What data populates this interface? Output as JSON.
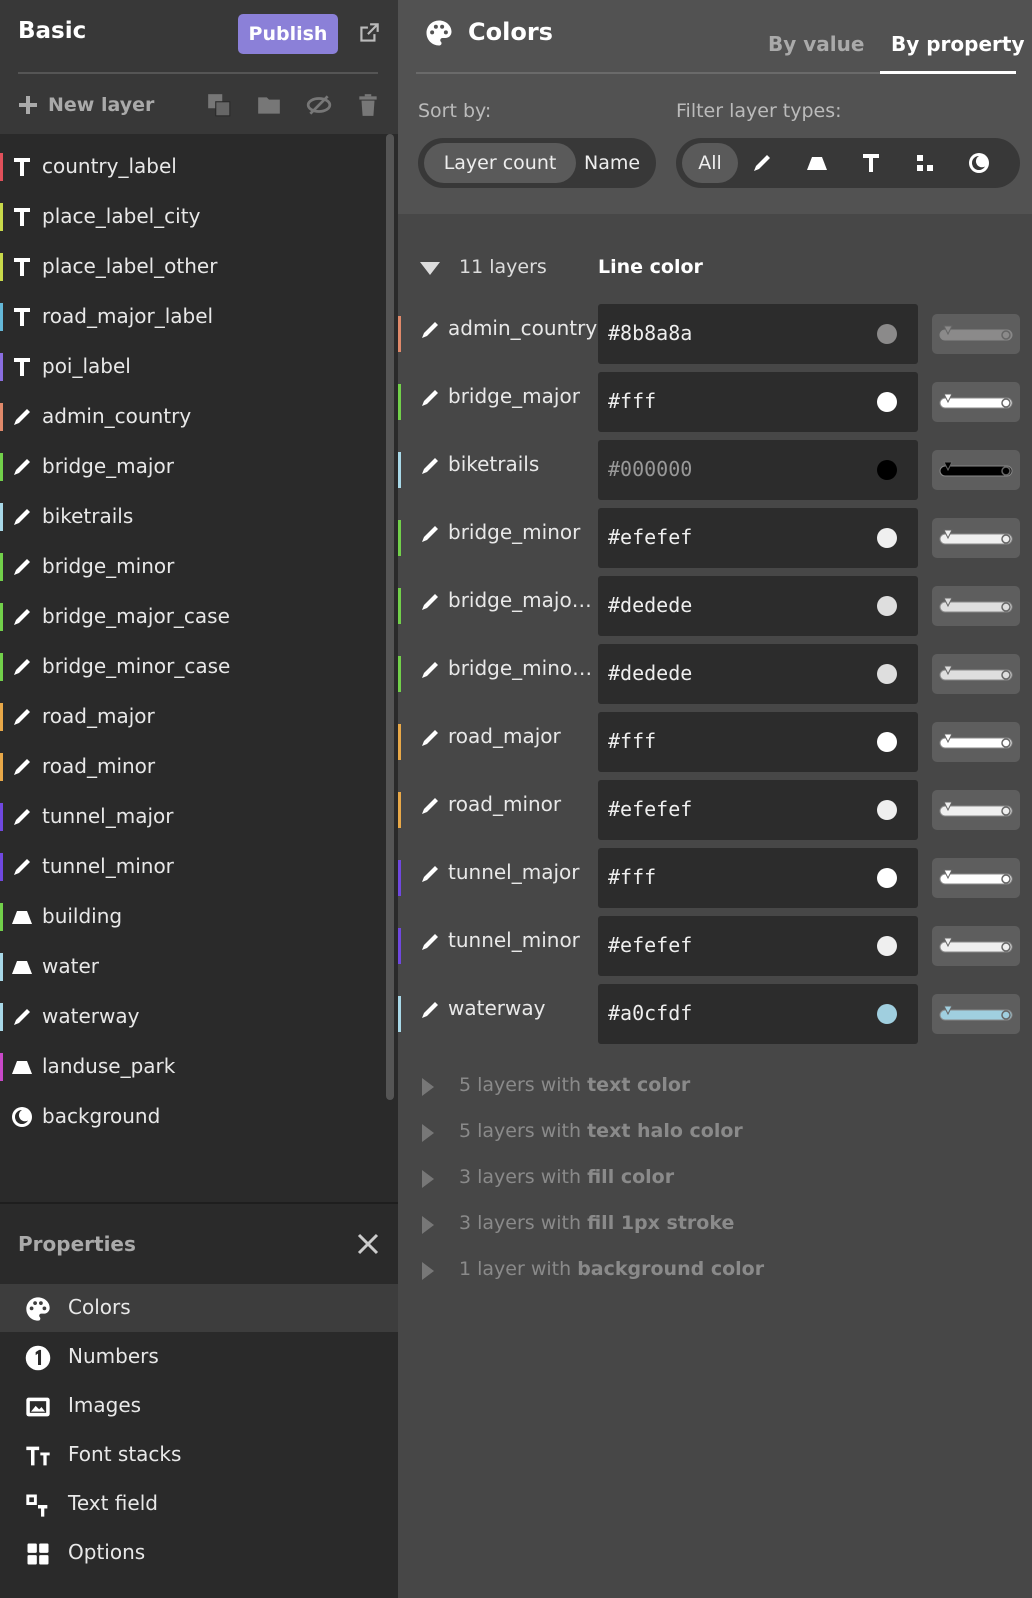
{
  "sidebar": {
    "title": "Basic",
    "publish_label": "Publish",
    "new_layer_label": "New layer",
    "layers": [
      {
        "name": "country_label",
        "type": "symbol-icon",
        "color": "#e0505a"
      },
      {
        "name": "place_label_city",
        "type": "symbol-icon",
        "color": "#c8d94a"
      },
      {
        "name": "place_label_other",
        "type": "symbol-icon",
        "color": "#c8d94a"
      },
      {
        "name": "road_major_label",
        "type": "symbol-icon",
        "color": "#64b8d8"
      },
      {
        "name": "poi_label",
        "type": "symbol-icon",
        "color": "#8a6ee0"
      },
      {
        "name": "admin_country",
        "type": "line-icon",
        "color": "#e0896a"
      },
      {
        "name": "bridge_major",
        "type": "line-icon",
        "color": "#72d04a"
      },
      {
        "name": "biketrails",
        "type": "line-icon",
        "color": "#a8d8e8"
      },
      {
        "name": "bridge_minor",
        "type": "line-icon",
        "color": "#72d04a"
      },
      {
        "name": "bridge_major_case",
        "type": "line-icon",
        "color": "#72d04a"
      },
      {
        "name": "bridge_minor_case",
        "type": "line-icon",
        "color": "#72d04a"
      },
      {
        "name": "road_major",
        "type": "line-icon",
        "color": "#e8a848"
      },
      {
        "name": "road_minor",
        "type": "line-icon",
        "color": "#e8a848"
      },
      {
        "name": "tunnel_major",
        "type": "line-icon",
        "color": "#7048e0"
      },
      {
        "name": "tunnel_minor",
        "type": "line-icon",
        "color": "#7048e0"
      },
      {
        "name": "building",
        "type": "fill-icon",
        "color": "#72d04a"
      },
      {
        "name": "water",
        "type": "fill-icon",
        "color": "#a8d8e8"
      },
      {
        "name": "waterway",
        "type": "line-icon",
        "color": "#a8d8e8"
      },
      {
        "name": "landuse_park",
        "type": "fill-icon",
        "color": "#c848c8"
      },
      {
        "name": "background",
        "type": "background-icon",
        "color": ""
      }
    ]
  },
  "properties": {
    "title": "Properties",
    "items": [
      {
        "label": "Colors",
        "icon": "palette-icon",
        "active": true
      },
      {
        "label": "Numbers",
        "icon": "number-icon",
        "active": false
      },
      {
        "label": "Images",
        "icon": "image-icon",
        "active": false
      },
      {
        "label": "Font stacks",
        "icon": "font-icon",
        "active": false
      },
      {
        "label": "Text field",
        "icon": "text-field-icon",
        "active": false
      },
      {
        "label": "Options",
        "icon": "options-grid-icon",
        "active": false
      }
    ]
  },
  "main": {
    "title": "Colors",
    "tabs": [
      {
        "label": "By value",
        "active": false
      },
      {
        "label": "By property",
        "active": true
      }
    ],
    "sort_label": "Sort by:",
    "sort_options": [
      "Layer count",
      "Name"
    ],
    "sort_selected": "Layer count",
    "filter_label": "Filter layer types:",
    "filter_all": "All",
    "group": {
      "count_label": "11 layers",
      "property_label": "Line color",
      "rows": [
        {
          "name": "admin_country",
          "value": "#8b8a8a",
          "swatch": "#8b8a8a",
          "bar": "#e0896a",
          "muted": false
        },
        {
          "name": "bridge_major",
          "value": "#fff",
          "swatch": "#ffffff",
          "bar": "#72d04a",
          "muted": false
        },
        {
          "name": "biketrails",
          "value": "#000000",
          "swatch": "#000000",
          "bar": "#a8d8e8",
          "muted": true
        },
        {
          "name": "bridge_minor",
          "value": "#efefef",
          "swatch": "#efefef",
          "bar": "#72d04a",
          "muted": false
        },
        {
          "name": "bridge_major_case",
          "value": "#dedede",
          "swatch": "#dedede",
          "bar": "#72d04a",
          "muted": false
        },
        {
          "name": "bridge_minor_case",
          "value": "#dedede",
          "swatch": "#dedede",
          "bar": "#72d04a",
          "muted": false
        },
        {
          "name": "road_major",
          "value": "#fff",
          "swatch": "#ffffff",
          "bar": "#e8a848",
          "muted": false
        },
        {
          "name": "road_minor",
          "value": "#efefef",
          "swatch": "#efefef",
          "bar": "#e8a848",
          "muted": false
        },
        {
          "name": "tunnel_major",
          "value": "#fff",
          "swatch": "#ffffff",
          "bar": "#7048e0",
          "muted": false
        },
        {
          "name": "tunnel_minor",
          "value": "#efefef",
          "swatch": "#efefef",
          "bar": "#7048e0",
          "muted": false
        },
        {
          "name": "waterway",
          "value": "#a0cfdf",
          "swatch": "#a0cfdf",
          "bar": "#a8d8e8",
          "muted": false
        }
      ]
    },
    "collapsed_groups": [
      {
        "prefix": "5 layers with",
        "property": "text color"
      },
      {
        "prefix": "5 layers with",
        "property": "text halo color"
      },
      {
        "prefix": "3 layers with",
        "property": "fill color"
      },
      {
        "prefix": "3 layers with",
        "property": "fill 1px stroke"
      },
      {
        "prefix": "1 layer with",
        "property": "background color"
      }
    ]
  }
}
